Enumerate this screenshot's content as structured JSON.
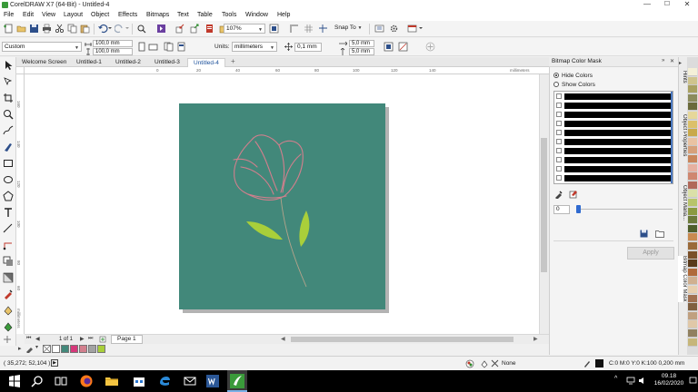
{
  "window": {
    "title": "CorelDRAW X7 (64-Bit) - Untitled-4",
    "controls": {
      "minimize": "—",
      "maximize": "☐",
      "close": "✕"
    }
  },
  "menu": [
    "File",
    "Edit",
    "View",
    "Layout",
    "Object",
    "Effects",
    "Bitmaps",
    "Text",
    "Table",
    "Tools",
    "Window",
    "Help"
  ],
  "standard_toolbar": {
    "zoom": "107%",
    "snap_to": "Snap To"
  },
  "property_bar": {
    "preset": "Custom",
    "width": "100,0 mm",
    "height": "100,0 mm",
    "units_label": "Units:",
    "units_value": "millimeters",
    "nudge": "0,1 mm",
    "dup_x": "5,0 mm",
    "dup_y": "5,0 mm"
  },
  "document_tabs": [
    {
      "label": "Welcome Screen",
      "active": false
    },
    {
      "label": "Untitled-1",
      "active": false
    },
    {
      "label": "Untitled-2",
      "active": false
    },
    {
      "label": "Untitled-3",
      "active": false
    },
    {
      "label": "Untitled-4",
      "active": true
    }
  ],
  "ruler": {
    "h_ticks": [
      "0",
      "20",
      "40",
      "60",
      "80",
      "100",
      "120",
      "140"
    ],
    "h_units": "millimeters",
    "v_ticks": [
      "160",
      "140",
      "120",
      "100",
      "80",
      "60",
      "40"
    ],
    "v_units": "millimeters"
  },
  "page_nav": {
    "counter": "1 of 1",
    "page_tab": "Page 1"
  },
  "status": {
    "coords": "( 35,272; 52,104 )",
    "fill_label": "None",
    "outline_label": "C:0 M:0 Y:0 K:100  0,200 mm"
  },
  "docker": {
    "title": "Bitmap Color Mask",
    "hide_colors": "Hide Colors",
    "show_colors": "Show Colors",
    "tolerance_value": "0",
    "apply": "Apply",
    "color_rows": 10
  },
  "side_tabs": [
    "Hints",
    "Object Properties",
    "Object Mana...",
    "Bitmap Color Mask"
  ],
  "taskbar": {
    "time": "09.18",
    "date": "16/02/2020"
  },
  "colors": {
    "artboard": "#42887a",
    "flower_outline": "#d27f8d",
    "leaf": "#a9cf3a",
    "accent_blue": "#1a4f9a"
  },
  "palette_swatches": [
    "#ffffff",
    "#42887a",
    "#d5387a",
    "#d27f8d",
    "#a2a2a2",
    "#a9cf3a"
  ],
  "right_palette": [
    "#f4f0d8",
    "#cfc48d",
    "#a8a060",
    "#8b8b5c",
    "#6a6a3a",
    "#e6d79a",
    "#dcc06a",
    "#c9a94a",
    "#e9c2a2",
    "#d6a07a",
    "#c8855a",
    "#e6b0a0",
    "#cf8770",
    "#b0685a",
    "#dbe0a8",
    "#b8c46a",
    "#8b9a40",
    "#6c7a3a",
    "#4e5e2a",
    "#c88a50",
    "#9a6a3a",
    "#7a502a",
    "#5a3a1a",
    "#b06a3a",
    "#d0b090",
    "#e8d0b0",
    "#a07050",
    "#806040",
    "#c0a080",
    "#e0c8a8",
    "#908060",
    "#c6b67a"
  ]
}
